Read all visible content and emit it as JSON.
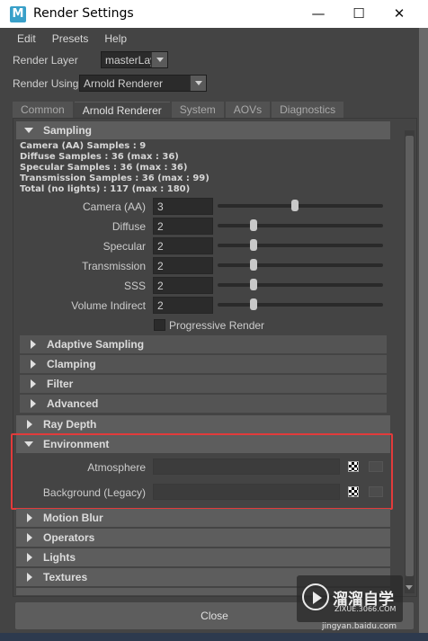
{
  "window": {
    "app_icon_letter": "M",
    "title": "Render Settings",
    "minimize_glyph": "—",
    "maximize_glyph": "☐",
    "close_glyph": "✕"
  },
  "menu": [
    "Edit",
    "Presets",
    "Help"
  ],
  "render_layer": {
    "label": "Render Layer",
    "value": "masterLayer"
  },
  "render_using": {
    "label": "Render Using",
    "value": "Arnold Renderer"
  },
  "tabs": [
    "Common",
    "Arnold Renderer",
    "System",
    "AOVs",
    "Diagnostics"
  ],
  "active_tab": "Arnold Renderer",
  "sampling": {
    "header": "Sampling",
    "info": [
      "Camera (AA) Samples : 9",
      "Diffuse Samples : 36 (max : 36)",
      "Specular Samples : 36 (max : 36)",
      "Transmission Samples : 36 (max : 99)",
      "Total (no lights) : 117 (max : 180)"
    ],
    "attributes": [
      {
        "label": "Camera (AA)",
        "value": "3",
        "slider_fraction": 0.47
      },
      {
        "label": "Diffuse",
        "value": "2",
        "slider_fraction": 0.22
      },
      {
        "label": "Specular",
        "value": "2",
        "slider_fraction": 0.22
      },
      {
        "label": "Transmission",
        "value": "2",
        "slider_fraction": 0.22
      },
      {
        "label": "SSS",
        "value": "2",
        "slider_fraction": 0.22
      },
      {
        "label": "Volume Indirect",
        "value": "2",
        "slider_fraction": 0.22
      }
    ],
    "progressive_render_label": "Progressive Render",
    "progressive_render_checked": false
  },
  "sampling_subsections": [
    "Adaptive Sampling",
    "Clamping",
    "Filter",
    "Advanced"
  ],
  "ray_depth": "Ray Depth",
  "environment": {
    "header": "Environment",
    "atmosphere_label": "Atmosphere",
    "background_label": "Background (Legacy)"
  },
  "collapsed_sections": [
    "Motion Blur",
    "Operators",
    "Lights",
    "Textures"
  ],
  "close_label": "Close",
  "watermark": {
    "title": "溜溜自学",
    "subtitle": "ZIXUE.3066.COM",
    "url": "jingyan.baidu.com"
  },
  "colors": {
    "highlight": "#e23b3b",
    "panel_bg": "#444444",
    "field_bg": "#2b2b2b"
  }
}
